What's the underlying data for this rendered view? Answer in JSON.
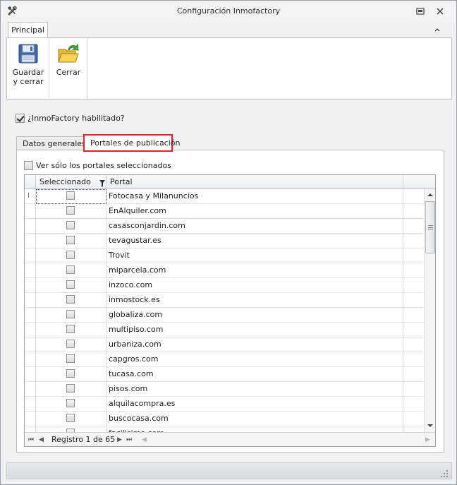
{
  "window": {
    "title": "Configuración Inmofactory"
  },
  "ribbon": {
    "tab_label": "Principal",
    "save_label_line1": "Guardar",
    "save_label_line2": "y cerrar",
    "close_label": "Cerrar"
  },
  "settings": {
    "enabled_label": "¿InmoFactory habilitado?",
    "enabled_checked": true
  },
  "tabs": {
    "general_label": "Datos generales",
    "portals_label": "Portales de publicación"
  },
  "portals": {
    "filter_label": "Ver sólo los portales seleccionados",
    "columns": {
      "selected": "Seleccionado",
      "portal": "Portal"
    },
    "rows": [
      "Fotocasa y Milanuncios",
      "EnAlquiler.com",
      "casasconjardin.com",
      "tevagustar.es",
      "Trovit",
      "miparcela.com",
      "inzoco.com",
      "inmostock.es",
      "globaliza.com",
      "multipiso.com",
      "urbaniza.com",
      "capgros.com",
      "tucasa.com",
      "pisos.com",
      "alquilacompra.es",
      "buscocasa.com",
      "facilisimo.com"
    ],
    "navigator": "Registro 1 de 65"
  },
  "icons": {
    "app": "tools-icon",
    "save": "floppy-disk-icon",
    "close": "folder-exit-icon",
    "filter": "funnel-icon"
  },
  "colors": {
    "highlight_border": "#e0232a"
  }
}
